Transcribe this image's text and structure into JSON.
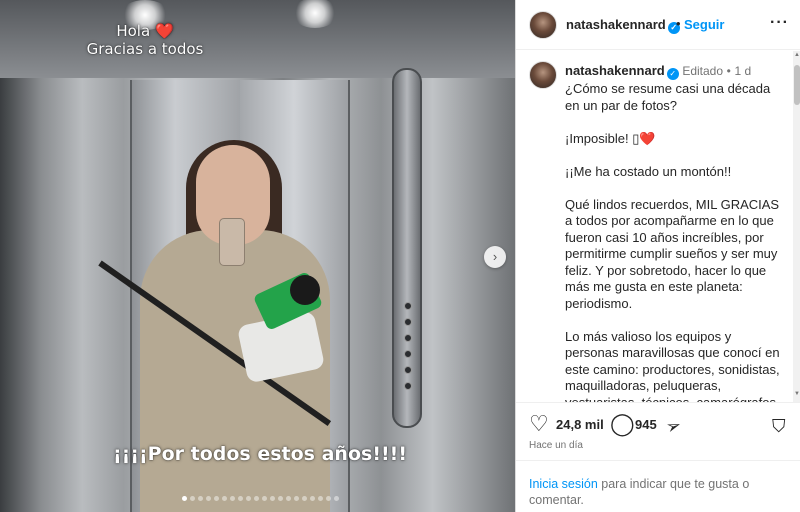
{
  "media": {
    "overlay_top_line1": "Hola",
    "overlay_top_heart": "❤️",
    "overlay_top_line2": "Gracias a todos",
    "overlay_bottom": "¡¡¡¡Por todos estos años!!!!",
    "next_icon": "chevron-right-icon",
    "next_glyph": "›",
    "carousel_count": 20,
    "carousel_active_index": 0
  },
  "header": {
    "username": "natashakennard",
    "verified_glyph": "✓",
    "separator": "•",
    "follow_label": "Seguir",
    "more_glyph": "···"
  },
  "caption": {
    "username": "natashakennard",
    "edited": "Editado",
    "separator": "•",
    "age": "1 d",
    "paragraph1": "¿Cómo se resume casi una década en un par de fotos?",
    "paragraph2_text": "¡Imposible! ",
    "paragraph2_box": "▯",
    "paragraph2_heart": "❤️",
    "paragraph3": "¡¡Me ha costado un montón!!",
    "paragraph4": "Qué lindos recuerdos, MIL GRACIAS a todos por acompañarme en lo que fueron casi 10 años increíbles, por permitirme cumplir sueños y ser muy feliz. Y por sobretodo, hacer lo que más me gusta en este planeta: periodismo.",
    "paragraph5": "Lo más valioso los equipos y personas maravillosas que conocí en este camino: productores, sonidistas, maquilladoras, peluqueras, vestuaristas, técnicos, camarógrafos, conductores, editores, reporteros, presentadores, todos!!! Y amigos para toda la vida."
  },
  "actions": {
    "like_glyph": "♡",
    "like_count": "24,8 mil",
    "comment_glyph": "◯",
    "comment_count": "945",
    "share_glyph": "➢",
    "save_glyph": "⛉",
    "time_ago": "Hace un día"
  },
  "login": {
    "link_label": "Inicia sesión",
    "rest_text": " para indicar que te gusta o comentar."
  },
  "colors": {
    "accent": "#0095f6",
    "heart": "#ff2b3f",
    "text": "#262626",
    "muted": "#737373"
  }
}
